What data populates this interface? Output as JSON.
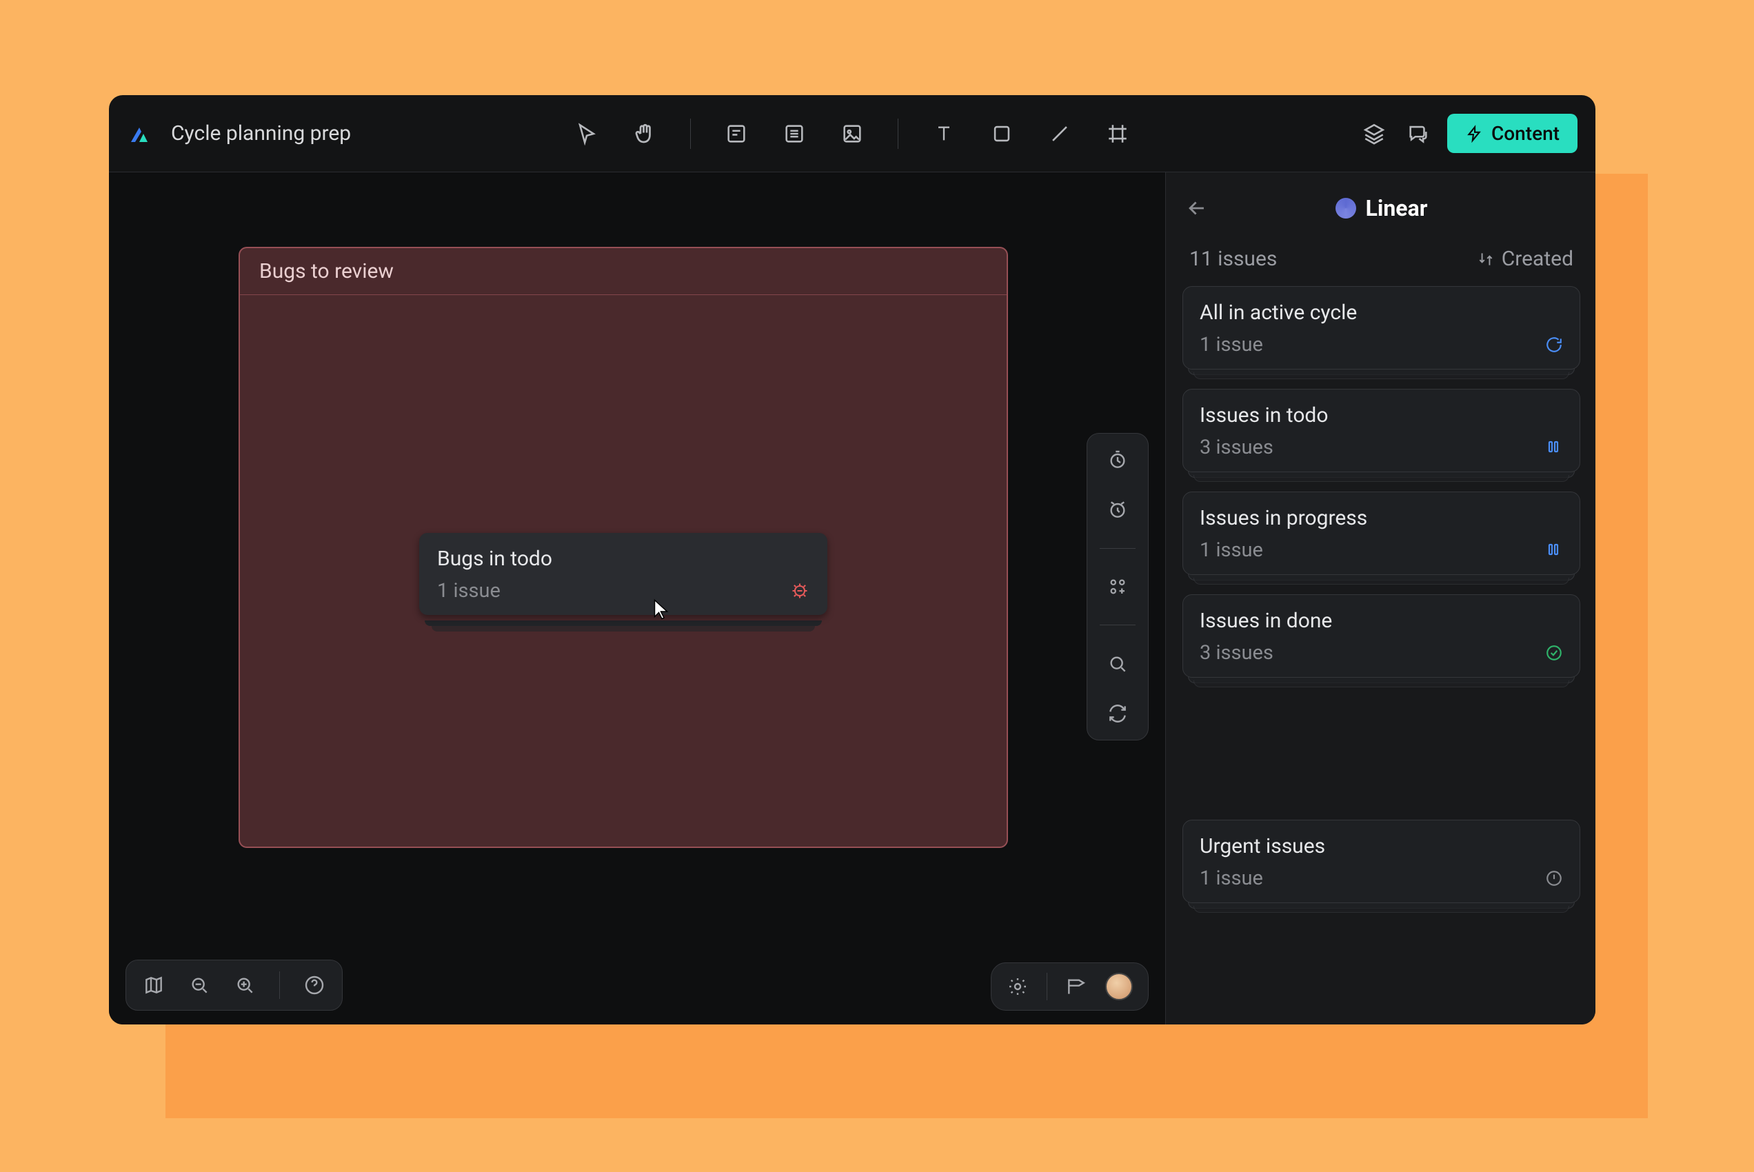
{
  "topbar": {
    "doc_title": "Cycle planning prep",
    "content_button": "Content"
  },
  "right_panel": {
    "title": "Linear",
    "issue_summary": "11 issues",
    "sort_label": "Created",
    "cards": [
      {
        "title": "All in active cycle",
        "count": "1 issue",
        "status": "cycle"
      },
      {
        "title": "Issues in todo",
        "count": "3 issues",
        "status": "todo"
      },
      {
        "title": "Issues in progress",
        "count": "1 issue",
        "status": "todo"
      },
      {
        "title": "Issues in done",
        "count": "3 issues",
        "status": "done"
      },
      {
        "title": "Urgent issues",
        "count": "1 issue",
        "status": "urgent"
      }
    ]
  },
  "canvas": {
    "section_title": "Bugs to review",
    "card": {
      "title": "Bugs in todo",
      "count": "1 issue"
    }
  },
  "icons": {
    "tools": [
      "cursor",
      "hand",
      "note",
      "text-block",
      "image",
      "text",
      "shape",
      "line",
      "frame"
    ],
    "vtoolbar": [
      "timer",
      "alarm",
      "apps",
      "search",
      "sync"
    ],
    "bl": [
      "map",
      "zoom-out",
      "zoom-in",
      "help"
    ],
    "br": [
      "settings-user",
      "present",
      "avatar"
    ]
  }
}
